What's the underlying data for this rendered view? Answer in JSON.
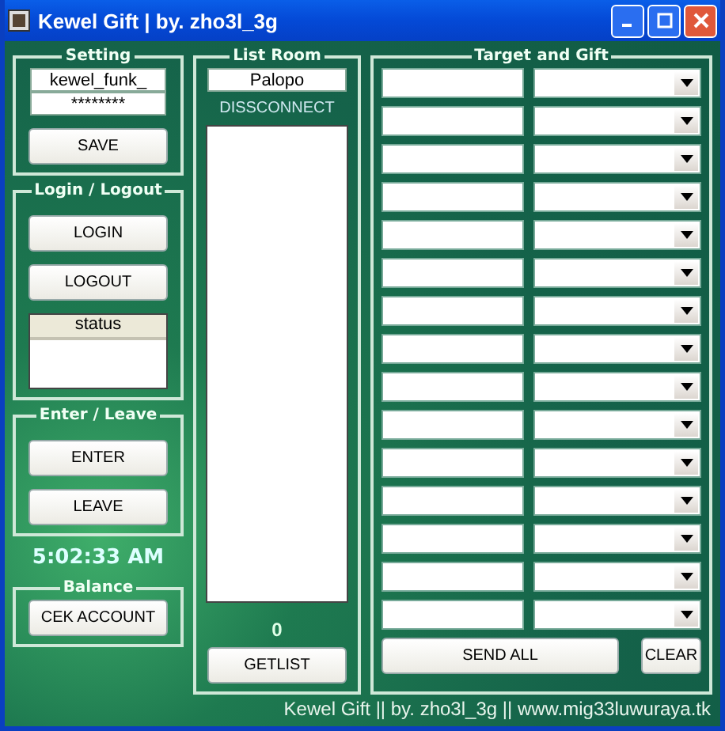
{
  "window": {
    "title": "Kewel Gift | by. zho3l_3g"
  },
  "setting": {
    "title": "Setting",
    "username": "kewel_funk_",
    "password": "********",
    "button": "SAVE"
  },
  "login": {
    "title": "Login / Logout",
    "buttons": [
      "LOGIN",
      "LOGOUT"
    ],
    "status_list": {
      "header": "status"
    }
  },
  "enter_leave": {
    "title": "Enter / Leave",
    "buttons": [
      "ENTER",
      "LEAVE"
    ]
  },
  "clock": "5:02:33 AM",
  "balance": {
    "title": "Balance",
    "button": "CEK ACCOUNT"
  },
  "list_room": {
    "title": "List Room",
    "room": "Palopo",
    "connection_status": "DISSCONNECT",
    "count": "0",
    "button": "GETLIST"
  },
  "target_gift": {
    "title": "Target and Gift",
    "rows": [
      {
        "kind": "target-gift"
      },
      {
        "kind": "target-gift"
      },
      {
        "kind": "target-gift"
      },
      {
        "kind": "target-gift"
      },
      {
        "kind": "target-gift"
      },
      {
        "kind": "target-gift"
      },
      {
        "kind": "target-gift"
      },
      {
        "kind": "target-gift"
      },
      {
        "kind": "target-gift"
      },
      {
        "kind": "target-gift"
      },
      {
        "kind": "target-gift"
      },
      {
        "kind": "target-gift"
      },
      {
        "kind": "target-gift"
      },
      {
        "kind": "target-gift"
      },
      {
        "kind": "target-gift"
      }
    ],
    "buttons": [
      "SEND ALL",
      "CLEAR"
    ]
  },
  "footer": "Kewel Gift || by. zho3l_3g || www.mig33luwuraya.tk"
}
